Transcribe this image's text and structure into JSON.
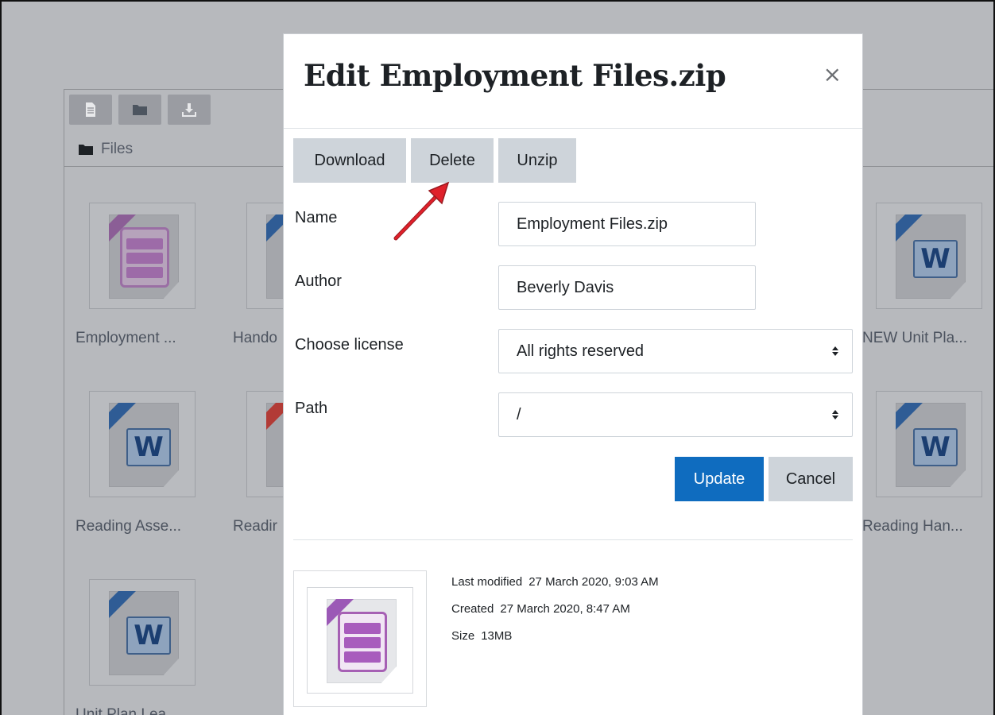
{
  "file_manager": {
    "path_label": "Files",
    "tiles_row1": [
      {
        "label": "Employment ...",
        "icon": "zip-file-icon"
      },
      {
        "label": "Hando",
        "icon": "word-file-icon"
      },
      {
        "label": "NEW Unit Pla...",
        "icon": "word-file-icon"
      }
    ],
    "tiles_row2": [
      {
        "label": "Reading Asse...",
        "icon": "word-file-icon"
      },
      {
        "label": "Readir",
        "icon": "pdf-file-icon"
      },
      {
        "label": "Reading Han...",
        "icon": "word-file-icon"
      }
    ],
    "tiles_row3": [
      {
        "label": "Unit Plan Lea",
        "icon": "word-file-icon"
      }
    ]
  },
  "modal": {
    "title": "Edit Employment Files.zip",
    "close_symbol": "×",
    "buttons": {
      "download": "Download",
      "delete": "Delete",
      "unzip": "Unzip",
      "update": "Update",
      "cancel": "Cancel"
    },
    "fields": {
      "name_label": "Name",
      "name_value": "Employment Files.zip",
      "author_label": "Author",
      "author_value": "Beverly Davis",
      "license_label": "Choose license",
      "license_value": "All rights reserved",
      "path_label": "Path",
      "path_value": "/"
    },
    "info": {
      "last_modified_label": "Last modified",
      "last_modified_value": "27 March 2020, 9:03 AM",
      "created_label": "Created",
      "created_value": "27 March 2020, 8:47 AM",
      "size_label": "Size",
      "size_value": "13MB"
    }
  },
  "colors": {
    "overlay": "#b7b9bd",
    "primary": "#0f6cbf",
    "secondary": "#ced4da",
    "annotation_arrow": "#e0202a"
  }
}
